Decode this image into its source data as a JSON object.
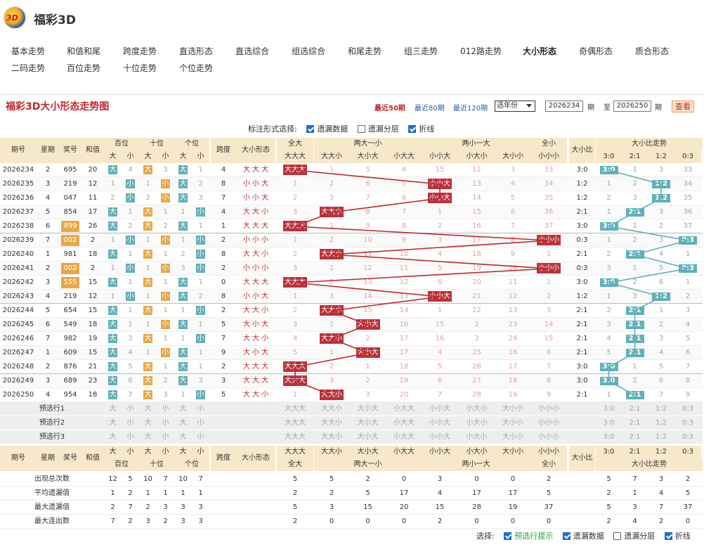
{
  "app": {
    "title": "福彩3D",
    "logo_text": "3D"
  },
  "nav": [
    "基本走势",
    "和值和尾",
    "跨度走势",
    "直选形态",
    "直选综合",
    "组选综合",
    "和尾走势",
    "组三走势",
    "012路走势",
    "大小形态",
    "奇偶形态",
    "质合形态",
    "二码走势",
    "百位走势",
    "十位走势",
    "个位走势"
  ],
  "nav_active": 9,
  "panel": {
    "title": "福彩3D大小形态走势图",
    "link50": "最近50期",
    "link80": "最近80期",
    "link120": "最近120期",
    "year_select": "选年份",
    "from": "2026234",
    "to": "2026250",
    "qi": "期",
    "zhi": "至",
    "query": "查看"
  },
  "mark_opts": {
    "label": "标注形式选择:",
    "o1": "遗漏数据",
    "o2": "遗漏分层",
    "o3": "折线"
  },
  "bottom_opts": {
    "label": "选择:",
    "o1": "预选行提示",
    "o2": "遗漏数据",
    "o3": "遗漏分层",
    "o4": "折线"
  },
  "headers": {
    "issue": "期号",
    "week": "星期",
    "prize": "奖号",
    "sum": "和值",
    "bai": "百位",
    "shi": "十位",
    "ge": "个位",
    "span": "跨度",
    "shape": "大小形态",
    "da": "大",
    "xiao": "小",
    "quanda": "全大",
    "liangda": "两大一小",
    "liangxiao": "两小一大",
    "quanxiao": "全小",
    "ratio": "大小比",
    "ratio_trend": "大小比走势",
    "p1": "大大大",
    "p2": "大大小",
    "p3": "大小大",
    "p4": "小大大",
    "p5": "小小大",
    "p6": "小大小",
    "p7": "大小小",
    "p8": "小小小",
    "r1": "3:0",
    "r2": "2:1",
    "r3": "1:2",
    "r4": "0:3"
  },
  "rows": [
    {
      "i": "2026234",
      "w": "2",
      "n": "695",
      "s": "20",
      "b": "大",
      "bm": "4",
      "t": "大",
      "tm": "3",
      "g": "大",
      "gm": "1",
      "sp": "4",
      "f": "大 大 大",
      "pat": 0,
      "pm": [
        "1",
        "5",
        "4",
        "15",
        "12",
        "3",
        "33"
      ],
      "r": "3:0",
      "ri": 0,
      "rm": [
        "1",
        "3",
        "33"
      ]
    },
    {
      "i": "2026235",
      "w": "3",
      "n": "219",
      "s": "12",
      "bm": "1",
      "b": "小",
      "tm": "1",
      "t": "小",
      "g": "大",
      "gm": "2",
      "sp": "8",
      "f": "小 小 大",
      "pat": 4,
      "pm": [
        "1",
        "2",
        "6",
        "5",
        "13",
        "4",
        "34"
      ],
      "r": "1:2",
      "ri": 2,
      "rm": [
        "1",
        "2",
        "34"
      ]
    },
    {
      "i": "2026236",
      "w": "4",
      "n": "047",
      "s": "11",
      "bm": "2",
      "b": "小",
      "tm": "2",
      "t": "小",
      "g": "大",
      "gm": "3",
      "sp": "7",
      "f": "小 小 大",
      "pat": 4,
      "pm": [
        "2",
        "3",
        "7",
        "6",
        "14",
        "5",
        "35"
      ],
      "r": "1:2",
      "ri": 2,
      "rm": [
        "2",
        "3",
        "35"
      ]
    },
    {
      "i": "2026237",
      "w": "5",
      "n": "854",
      "s": "17",
      "b": "大",
      "bm": "1",
      "t": "大",
      "tm": "1",
      "gm": "1",
      "g": "小",
      "sp": "4",
      "f": "大 大 小",
      "pat": 1,
      "pm": [
        "3",
        "8",
        "7",
        "1",
        "15",
        "6",
        "36"
      ],
      "r": "2:1",
      "ri": 1,
      "rm": [
        "1",
        "3",
        "36"
      ]
    },
    {
      "i": "2026238",
      "w": "6",
      "n": "899",
      "s": "26",
      "b": "大",
      "bm": "2",
      "t": "大",
      "tm": "2",
      "g": "大",
      "gm": "1",
      "sp": "1",
      "f": "大 大 大",
      "pat": 0,
      "pm": [
        "1",
        "9",
        "8",
        "2",
        "16",
        "7",
        "37"
      ],
      "r": "3:0",
      "ri": 0,
      "rm": [
        "1",
        "2",
        "37"
      ],
      "hl": true
    },
    {
      "i": "2026239",
      "w": "7",
      "n": "002",
      "s": "2",
      "bm": "1",
      "b": "小",
      "tm": "1",
      "t": "小",
      "gm": "1",
      "g": "小",
      "sp": "2",
      "f": "小 小 小",
      "pat": 7,
      "pm": [
        "1",
        "2",
        "10",
        "9",
        "3",
        "17",
        "8"
      ],
      "r": "0:3",
      "ri": 3,
      "rm": [
        "1",
        "2",
        "3"
      ],
      "hl": true
    },
    {
      "i": "2026240",
      "w": "1",
      "n": "981",
      "s": "18",
      "b": "大",
      "bm": "1",
      "t": "大",
      "tm": "1",
      "gm": "2",
      "g": "小",
      "sp": "8",
      "f": "大 大 小",
      "pat": 1,
      "pm": [
        "2",
        "11",
        "10",
        "4",
        "18",
        "9",
        "1"
      ],
      "r": "2:1",
      "ri": 1,
      "rm": [
        "2",
        "4",
        "1"
      ]
    },
    {
      "i": "2026241",
      "w": "2",
      "n": "002",
      "s": "2",
      "bm": "1",
      "b": "小",
      "tm": "1",
      "t": "小",
      "gm": "3",
      "g": "小",
      "sp": "2",
      "f": "小 小 小",
      "pat": 7,
      "pm": [
        "3",
        "1",
        "12",
        "11",
        "5",
        "19",
        "10"
      ],
      "r": "0:3",
      "ri": 3,
      "rm": [
        "3",
        "1",
        "5"
      ],
      "hl": true
    },
    {
      "i": "2026242",
      "w": "3",
      "n": "555",
      "s": "15",
      "b": "大",
      "bm": "1",
      "t": "大",
      "tm": "1",
      "g": "大",
      "gm": "1",
      "sp": "0",
      "f": "大 大 大",
      "pat": 0,
      "pm": [
        "2",
        "13",
        "12",
        "6",
        "20",
        "11",
        "1"
      ],
      "r": "3:0",
      "ri": 0,
      "rm": [
        "2",
        "6",
        "1"
      ],
      "hl": true
    },
    {
      "i": "2026243",
      "w": "4",
      "n": "219",
      "s": "12",
      "bm": "1",
      "b": "小",
      "tm": "1",
      "t": "小",
      "g": "大",
      "gm": "2",
      "sp": "8",
      "f": "小 小 大",
      "pat": 4,
      "pm": [
        "1",
        "3",
        "14",
        "13",
        "21",
        "12",
        "2"
      ],
      "r": "1:2",
      "ri": 2,
      "rm": [
        "1",
        "3",
        "2"
      ]
    },
    {
      "i": "2026244",
      "w": "5",
      "n": "654",
      "s": "15",
      "b": "大",
      "bm": "1",
      "t": "大",
      "tm": "1",
      "gm": "1",
      "g": "小",
      "sp": "2",
      "f": "大 大 小",
      "pat": 1,
      "pm": [
        "2",
        "15",
        "14",
        "1",
        "22",
        "13",
        "3"
      ],
      "r": "2:1",
      "ri": 1,
      "rm": [
        "2",
        "1",
        "3"
      ]
    },
    {
      "i": "2026245",
      "w": "6",
      "n": "549",
      "s": "18",
      "b": "大",
      "bm": "1",
      "tm": "1",
      "t": "小",
      "g": "大",
      "gm": "1",
      "sp": "5",
      "f": "大 小 大",
      "pat": 2,
      "pm": [
        "3",
        "1",
        "16",
        "15",
        "2",
        "23",
        "14"
      ],
      "r": "2:1",
      "ri": 1,
      "rm": [
        "3",
        "2",
        "4"
      ]
    },
    {
      "i": "2026246",
      "w": "7",
      "n": "982",
      "s": "19",
      "b": "大",
      "bm": "3",
      "t": "大",
      "tm": "1",
      "gm": "1",
      "g": "小",
      "sp": "7",
      "f": "大 大 小",
      "pat": 1,
      "pm": [
        "4",
        "2",
        "17",
        "16",
        "3",
        "24",
        "15"
      ],
      "r": "2:1",
      "ri": 1,
      "rm": [
        "4",
        "3",
        "5"
      ]
    },
    {
      "i": "2026247",
      "w": "1",
      "n": "609",
      "s": "15",
      "b": "大",
      "bm": "4",
      "tm": "1",
      "t": "小",
      "g": "大",
      "gm": "1",
      "sp": "9",
      "f": "大 小 大",
      "pat": 2,
      "pm": [
        "5",
        "1",
        "17",
        "4",
        "25",
        "16",
        "6"
      ],
      "r": "2:1",
      "ri": 1,
      "rm": [
        "5",
        "4",
        "6"
      ]
    },
    {
      "i": "2026248",
      "w": "2",
      "n": "876",
      "s": "21",
      "b": "大",
      "bm": "5",
      "t": "大",
      "tm": "1",
      "g": "大",
      "gm": "1",
      "sp": "2",
      "f": "大 大 大",
      "pat": 0,
      "pm": [
        "2",
        "1",
        "18",
        "5",
        "26",
        "17",
        "7"
      ],
      "r": "3:0",
      "ri": 0,
      "rm": [
        "1",
        "5",
        "7"
      ]
    },
    {
      "i": "2026249",
      "w": "3",
      "n": "689",
      "s": "23",
      "b": "大",
      "bm": "6",
      "t": "大",
      "tm": "2",
      "g": "大",
      "gm": "3",
      "sp": "3",
      "f": "大 大 大",
      "pat": 0,
      "pm": [
        "3",
        "2",
        "19",
        "6",
        "27",
        "18",
        "8"
      ],
      "r": "3:0",
      "ri": 0,
      "rm": [
        "2",
        "6",
        "8"
      ]
    },
    {
      "i": "2026250",
      "w": "4",
      "n": "954",
      "s": "18",
      "b": "大",
      "bm": "7",
      "t": "大",
      "tm": "3",
      "gm": "1",
      "g": "小",
      "sp": "5",
      "f": "大 大 小",
      "pat": 1,
      "pm": [
        "1",
        "3",
        "20",
        "7",
        "28",
        "19",
        "9"
      ],
      "r": "2:1",
      "ri": 1,
      "rm": [
        "1",
        "7",
        "9"
      ]
    }
  ],
  "preselect": [
    "预选行1",
    "预选行2",
    "预选行3"
  ],
  "stats": [
    {
      "label": "出现总次数",
      "v": [
        "12",
        "5",
        "10",
        "7",
        "10",
        "7",
        "",
        "",
        "5",
        "5",
        "2",
        "0",
        "3",
        "0",
        "0",
        "2",
        "",
        "5",
        "7",
        "3",
        "2"
      ]
    },
    {
      "label": "平均遗漏值",
      "v": [
        "1",
        "2",
        "1",
        "1",
        "1",
        "1",
        "",
        "",
        "2",
        "2",
        "5",
        "17",
        "4",
        "17",
        "17",
        "5",
        "",
        "2",
        "1",
        "4",
        "5"
      ]
    },
    {
      "label": "最大遗漏值",
      "v": [
        "2",
        "7",
        "2",
        "3",
        "3",
        "3",
        "",
        "",
        "5",
        "3",
        "15",
        "20",
        "15",
        "28",
        "19",
        "37",
        "",
        "5",
        "3",
        "7",
        "37"
      ]
    },
    {
      "label": "最大连出数",
      "v": [
        "7",
        "2",
        "3",
        "2",
        "3",
        "3",
        "",
        "",
        "2",
        "0",
        "0",
        "0",
        "2",
        "0",
        "0",
        "0",
        "",
        "2",
        "4",
        "2",
        "0"
      ]
    }
  ],
  "colors": {
    "accent": "#c0282e",
    "header_bg": "#f6e8c9",
    "big_box": "#62b0b8",
    "small_box": "#e5a84a",
    "line_red": "#c0282e",
    "line_teal": "#62b0b8"
  }
}
